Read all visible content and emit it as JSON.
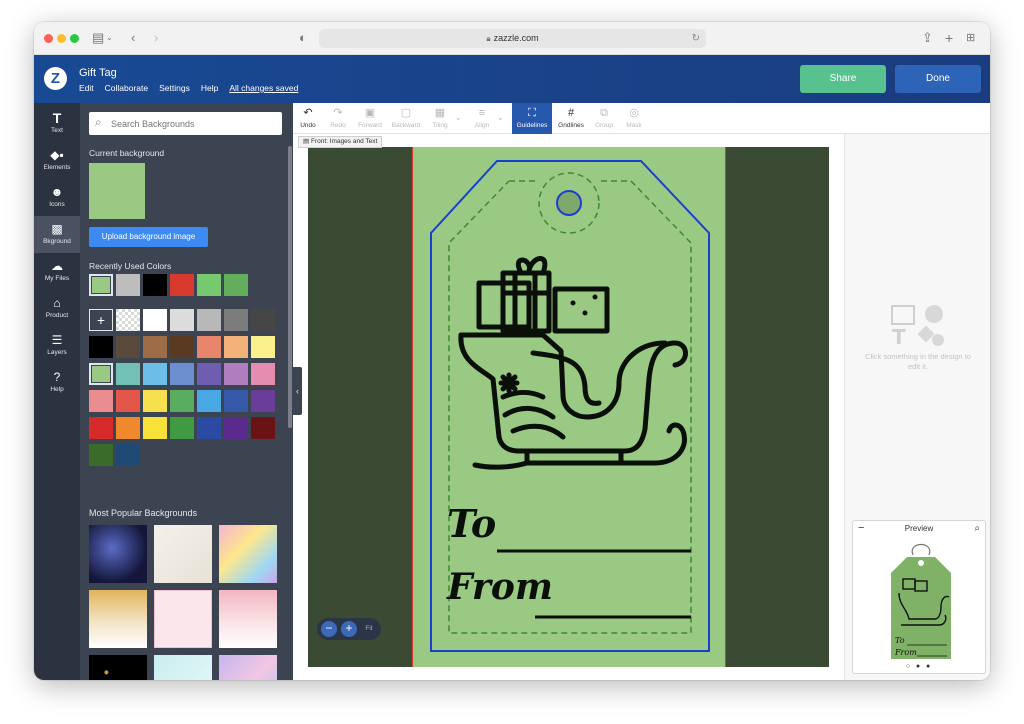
{
  "browser": {
    "url": "zazzle.com"
  },
  "header": {
    "logo": "Z",
    "title": "Gift Tag",
    "menu": [
      "Edit",
      "Collaborate",
      "Settings",
      "Help"
    ],
    "saved_status": "All changes saved",
    "share_label": "Share",
    "done_label": "Done"
  },
  "rail": [
    {
      "label": "Text",
      "icon": "text-icon"
    },
    {
      "label": "Elements",
      "icon": "elements-icon"
    },
    {
      "label": "Icons",
      "icon": "smiley-icon"
    },
    {
      "label": "Bkground",
      "icon": "background-icon"
    },
    {
      "label": "My Files",
      "icon": "cloud-upload-icon"
    },
    {
      "label": "Product",
      "icon": "product-icon"
    },
    {
      "label": "Layers",
      "icon": "layers-icon"
    },
    {
      "label": "Help",
      "icon": "help-icon"
    }
  ],
  "panel": {
    "search_placeholder": "Search Backgrounds",
    "current_label": "Current background",
    "current_color": "#99c983",
    "upload_label": "Upload background image",
    "recent_label": "Recently Used Colors",
    "recent_colors": [
      "#99c983",
      "#bdbdbd",
      "#000000",
      "#d93a2f",
      "#76c96f",
      "#64ad5d"
    ],
    "add_label": "+",
    "palette": [
      [
        "transparent",
        "#ffffff",
        "#dcdcdc",
        "#b8b8b8",
        "#7c7c7c",
        "#464646"
      ],
      [
        "#000000",
        "#5a4a3c",
        "#9d6e46",
        "#5b3a22",
        "#e8856a",
        "#f2b27a",
        "#faf08c"
      ],
      [
        "#99c983",
        "#73c1b5",
        "#6cbde8",
        "#6b8fcf",
        "#6e5db0",
        "#b07ebf",
        "#e58dae"
      ],
      [
        "#ea8d8f",
        "#e3564a",
        "#f6e04e",
        "#5aad5e",
        "#4aa9e4",
        "#3559a8",
        "#6a3d9a"
      ],
      [
        "#d72b2b",
        "#f0892b",
        "#f8e23a",
        "#3f9a41",
        "#2b4aa2",
        "#5a2a8c",
        "#6b1314"
      ],
      [
        "#3b6b2a",
        "#1f4a75"
      ]
    ],
    "popular_label": "Most Popular Backgrounds"
  },
  "toolbar": [
    {
      "label": "Undo",
      "icon": "undo-icon",
      "state": "enabled"
    },
    {
      "label": "Redo",
      "icon": "redo-icon",
      "state": "disabled"
    },
    {
      "label": "Forward",
      "icon": "forward-icon",
      "state": "disabled"
    },
    {
      "label": "Backward",
      "icon": "backward-icon",
      "state": "disabled"
    },
    {
      "label": "Tiling",
      "icon": "tiling-icon",
      "state": "disabled"
    },
    {
      "label": "Align",
      "icon": "align-icon",
      "state": "disabled"
    },
    {
      "label": "Guidelines",
      "icon": "guidelines-icon",
      "state": "active"
    },
    {
      "label": "Gridlines",
      "icon": "gridlines-icon",
      "state": "enabled"
    },
    {
      "label": "Group",
      "icon": "group-icon",
      "state": "disabled"
    },
    {
      "label": "Mask",
      "icon": "mask-icon",
      "state": "disabled"
    }
  ],
  "canvas": {
    "side_tab": "Front: Images and Text",
    "to_label": "To",
    "from_label": "From",
    "zoom_minus": "−",
    "zoom_plus": "+",
    "zoom_fit": "Fit"
  },
  "right_panel": {
    "hint": "Click something in the design to edit it.",
    "preview_title": "Preview",
    "preview_minimize": "−",
    "preview_dots": "○ ● ●"
  }
}
